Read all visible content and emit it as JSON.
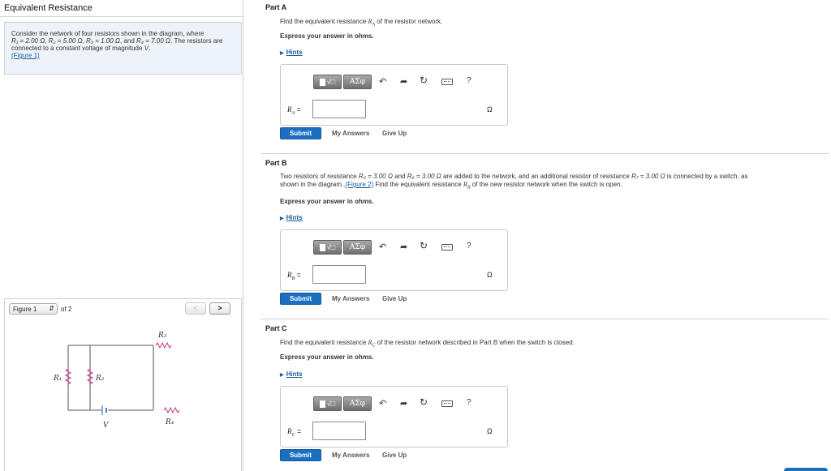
{
  "left": {
    "title": "Equivalent Resistance",
    "problem": {
      "text_1": "Consider the network of four resistors shown in the diagram, where",
      "r1": "R₁ = 2.00 Ω",
      "r2": "R₂ = 5.00 Ω",
      "r3": "R₃ = 1.00 Ω",
      "r4": "R₄ = 7.00 Ω",
      "text_2": "The resistors are connected to a constant voltage of magnitude",
      "v": "V",
      "figure_link": "(Figure 1)"
    },
    "figure": {
      "selected": "Figure 1",
      "of_text": "of 2",
      "prev": "<",
      "next": ">",
      "labels": {
        "r1": "R₁",
        "r2": "R₂",
        "r3": "R₃",
        "r4": "R₄",
        "v": "V"
      }
    }
  },
  "parts": {
    "a": {
      "title": "Part A",
      "prompt": "Find the equivalent resistance Rₐ of the resistor network.",
      "prompt_pre": "Find the equivalent resistance ",
      "prompt_var": "R",
      "prompt_sub": "A",
      "prompt_post": " of the resistor network.",
      "express": "Express your answer in ohms.",
      "hints": "Hints",
      "var": "R",
      "var_sub": "A",
      "eq": " =",
      "unit": "Ω",
      "submit": "Submit",
      "my_answers": "My Answers",
      "give_up": "Give Up"
    },
    "b": {
      "title": "Part B",
      "line1_pre": "Two resistors of resistance ",
      "r5": "R₅ = 3.00 Ω",
      "and": " and ",
      "r6": "R₆ = 3.00 Ω",
      "line1_mid": " are added to the network, and an additional resistor of resistance ",
      "r7": "R₇ = 3.00 Ω",
      "line1_post": " is connected by a switch, as",
      "line2_pre": "shown in the diagram..",
      "figure_link": "(Figure 2)",
      "line2_mid": " Find the equivalent resistance ",
      "line2_var": "R",
      "line2_sub": "B",
      "line2_post": " of the new resistor network when the switch is open.",
      "express": "Express your answer in ohms.",
      "hints": "Hints",
      "var": "R",
      "var_sub": "B",
      "eq": " =",
      "unit": "Ω",
      "submit": "Submit",
      "my_answers": "My Answers",
      "give_up": "Give Up"
    },
    "c": {
      "title": "Part C",
      "prompt_pre": "Find the equivalent resistance ",
      "prompt_var": "R",
      "prompt_sub": "C",
      "prompt_post": " of the resistor network described in Part B when the switch is closed.",
      "express": "Express your answer in ohms.",
      "hints": "Hints",
      "var": "R",
      "var_sub": "C",
      "eq": " =",
      "unit": "Ω",
      "submit": "Submit",
      "my_answers": "My Answers",
      "give_up": "Give Up"
    }
  },
  "toolbar": {
    "templates_label": "√□",
    "symbols_label": "AΣφ",
    "undo_icon": "undo-icon",
    "redo_icon": "redo-icon",
    "reset_icon": "reset-icon",
    "keyboard_icon": "keyboard-icon",
    "help": "?"
  },
  "colors": {
    "accent": "#1b6fc1",
    "link": "#1a5c9e",
    "problem_bg": "#eef3fa",
    "resistor": "#c0398a"
  }
}
